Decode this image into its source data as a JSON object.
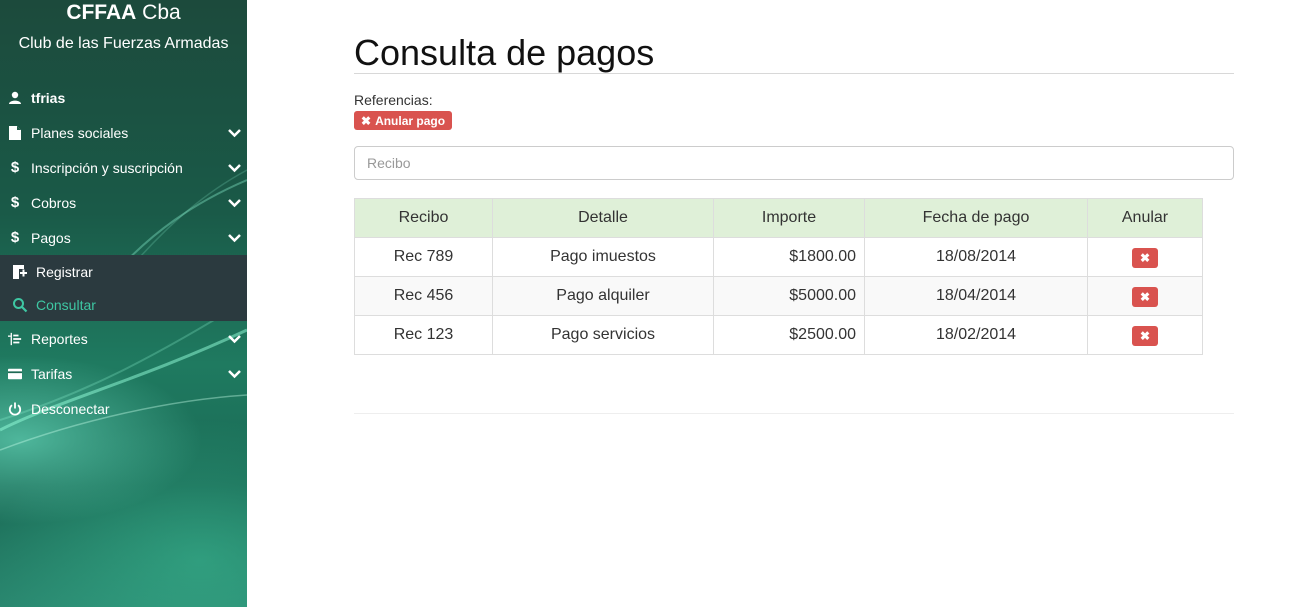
{
  "brand": {
    "title_bold": "CFFAA",
    "title_rest": "Cba",
    "subtitle": "Club de las Fuerzas Armadas"
  },
  "user": {
    "name": "tfrias",
    "icon": "user-icon"
  },
  "nav": [
    {
      "label": "Planes sociales",
      "icon": "file-icon"
    },
    {
      "label": "Inscripción y suscripción",
      "icon": "dollar-icon"
    },
    {
      "label": "Cobros",
      "icon": "dollar-icon"
    },
    {
      "label": "Pagos",
      "icon": "dollar-icon"
    }
  ],
  "submenu": [
    {
      "label": "Registrar",
      "icon": "register-icon"
    },
    {
      "label": "Consultar",
      "icon": "search-icon"
    }
  ],
  "nav2": [
    {
      "label": "Reportes",
      "icon": "list-icon"
    },
    {
      "label": "Tarifas",
      "icon": "card-icon"
    },
    {
      "label": "Desconectar",
      "icon": "power-icon"
    }
  ],
  "page": {
    "title": "Consulta de pagos",
    "references_label": "Referencias:",
    "reference_badge": "Anular pago",
    "search_placeholder": "Recibo"
  },
  "table": {
    "headers": [
      "Recibo",
      "Detalle",
      "Importe",
      "Fecha de pago",
      "Anular"
    ],
    "rows": [
      {
        "recibo": "Rec 789",
        "detalle": "Pago imuestos",
        "importe": "$1800.00",
        "fecha": "18/08/2014"
      },
      {
        "recibo": "Rec 456",
        "detalle": "Pago alquiler",
        "importe": "$5000.00",
        "fecha": "18/04/2014"
      },
      {
        "recibo": "Rec 123",
        "detalle": "Pago servicios",
        "importe": "$2500.00",
        "fecha": "18/02/2014"
      }
    ]
  },
  "colors": {
    "danger": "#d9534f",
    "table_header": "#dff0d8",
    "active_sub": "#3ec7a3",
    "submenu_bg": "#2b3a3f"
  }
}
